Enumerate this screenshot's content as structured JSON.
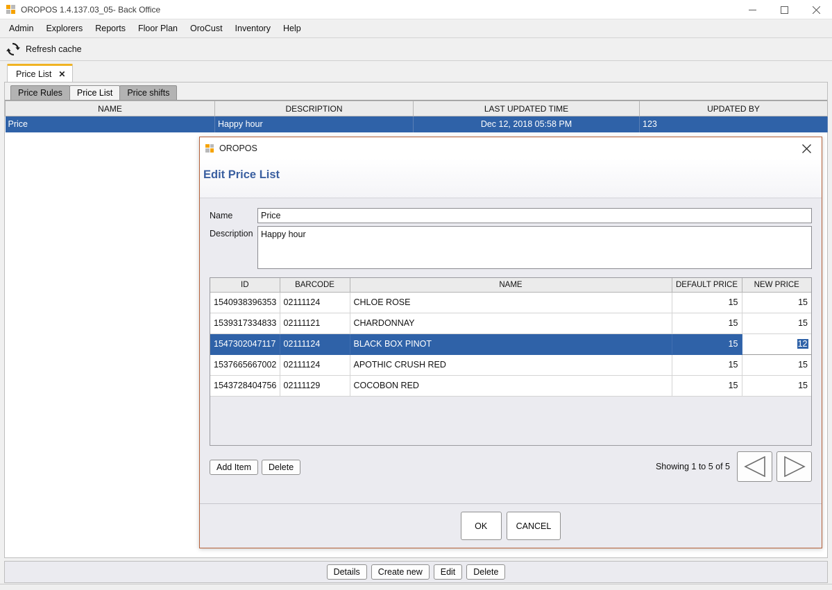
{
  "window": {
    "title": "OROPOS 1.4.137.03_05- Back Office",
    "icon": "oropos-logo-icon",
    "controls": {
      "minimize": "minimize-icon",
      "maximize": "maximize-icon",
      "close": "close-icon"
    }
  },
  "menu": {
    "items": [
      {
        "label": "Admin"
      },
      {
        "label": "Explorers"
      },
      {
        "label": "Reports"
      },
      {
        "label": "Floor Plan"
      },
      {
        "label": "OroCust"
      },
      {
        "label": "Inventory"
      },
      {
        "label": "Help"
      }
    ]
  },
  "toolbar": {
    "refresh_icon": "refresh-icon",
    "refresh_label": "Refresh cache"
  },
  "main_tab": {
    "label": "Price List",
    "close": "✕"
  },
  "subtabs": [
    {
      "label": "Price Rules",
      "active": false
    },
    {
      "label": "Price List",
      "active": true
    },
    {
      "label": "Price shifts",
      "active": false
    }
  ],
  "background_grid": {
    "columns": [
      "NAME",
      "DESCRIPTION",
      "LAST UPDATED TIME",
      "UPDATED BY"
    ],
    "rows": [
      {
        "name": "Price",
        "description": "Happy hour",
        "last_updated_time": "Dec 12, 2018 05:58 PM",
        "updated_by": "123",
        "selected": true
      }
    ]
  },
  "bottom_buttons": [
    {
      "label": "Details"
    },
    {
      "label": "Create new"
    },
    {
      "label": "Edit"
    },
    {
      "label": "Delete"
    }
  ],
  "dialog": {
    "icon": "oropos-logo-icon",
    "title": "OROPOS",
    "close": "✕",
    "heading": "Edit Price List",
    "form": {
      "name_label": "Name",
      "name_value": "Price",
      "description_label": "Description",
      "description_value": "Happy hour"
    },
    "item_table": {
      "columns": [
        "ID",
        "BARCODE",
        "NAME",
        "DEFAULT PRICE",
        "NEW PRICE"
      ],
      "rows": [
        {
          "id": "1540938396353",
          "barcode": "02111124",
          "name": "CHLOE ROSE",
          "default_price": "15",
          "new_price": "15",
          "selected": false,
          "editing": false
        },
        {
          "id": "1539317334833",
          "barcode": "02111121",
          "name": "CHARDONNAY",
          "default_price": "15",
          "new_price": "15",
          "selected": false,
          "editing": false
        },
        {
          "id": "1547302047117",
          "barcode": "02111124",
          "name": "BLACK BOX PINOT",
          "default_price": "15",
          "new_price": "12",
          "selected": true,
          "editing": true
        },
        {
          "id": "1537665667002",
          "barcode": "02111124",
          "name": "APOTHIC CRUSH RED",
          "default_price": "15",
          "new_price": "15",
          "selected": false,
          "editing": false
        },
        {
          "id": "1543728404756",
          "barcode": "02111129",
          "name": "COCOBON RED",
          "default_price": "15",
          "new_price": "15",
          "selected": false,
          "editing": false
        }
      ]
    },
    "table_footer": {
      "add_item_label": "Add Item",
      "delete_label": "Delete",
      "showing_text": "Showing 1 to 5 of 5",
      "prev_icon": "previous-page-icon",
      "next_icon": "next-page-icon"
    },
    "buttons": {
      "ok_label": "OK",
      "cancel_label": "CANCEL"
    }
  },
  "colors": {
    "selection_blue": "#2f62a8",
    "accent_orange": "#f0b323",
    "heading_blue": "#3a5fa0",
    "dialog_border": "#b5613a"
  }
}
